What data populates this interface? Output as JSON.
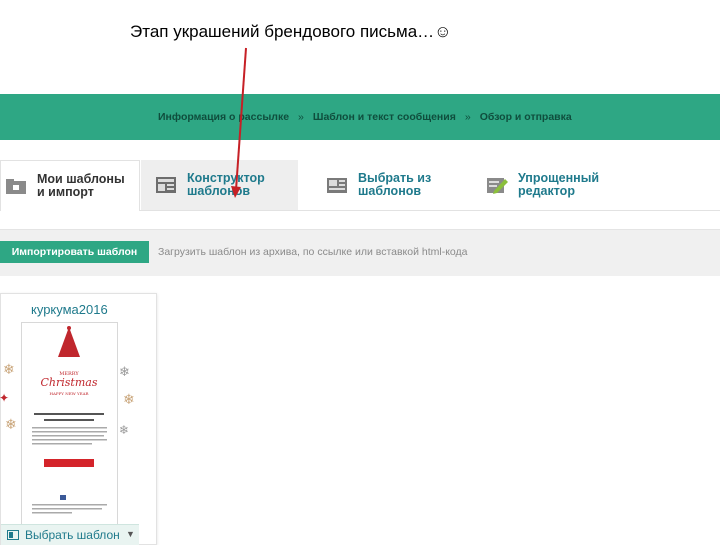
{
  "slide_title": "Этап украшений брендового письма…☺",
  "steps": [
    {
      "label": "Информация о рассылке"
    },
    {
      "label": "Шаблон и текст сообщения"
    },
    {
      "label": "Обзор и отправка"
    }
  ],
  "step_separator": "»",
  "tabs": [
    {
      "label": "Мои шаблоны\nи импорт",
      "icon": "folder-import-icon"
    },
    {
      "label": "Конструктор\nшаблонов",
      "icon": "layout-builder-icon"
    },
    {
      "label": "Выбрать из\nшаблонов",
      "icon": "template-gallery-icon"
    },
    {
      "label": "Упрощенный\nредактор",
      "icon": "pencil-edit-icon"
    }
  ],
  "import": {
    "button_label": "Импортировать шаблон",
    "hint": "Загрузить шаблон из архива, по ссылке или вставкой html-кода"
  },
  "template_card": {
    "title": "куркума2016",
    "preview": {
      "headline_top": "MERRY",
      "headline": "Christmas",
      "headline_bottom": "HAPPY NEW YEAR",
      "button_color": "#d4242a"
    },
    "choose_label": "Выбрать шаблон",
    "dropdown_glyph": "▼"
  },
  "colors": {
    "accent_green": "#2ea784",
    "link_blue": "#1f7a8c",
    "christmas_red": "#c0272d",
    "arrow_red": "#c62026"
  }
}
